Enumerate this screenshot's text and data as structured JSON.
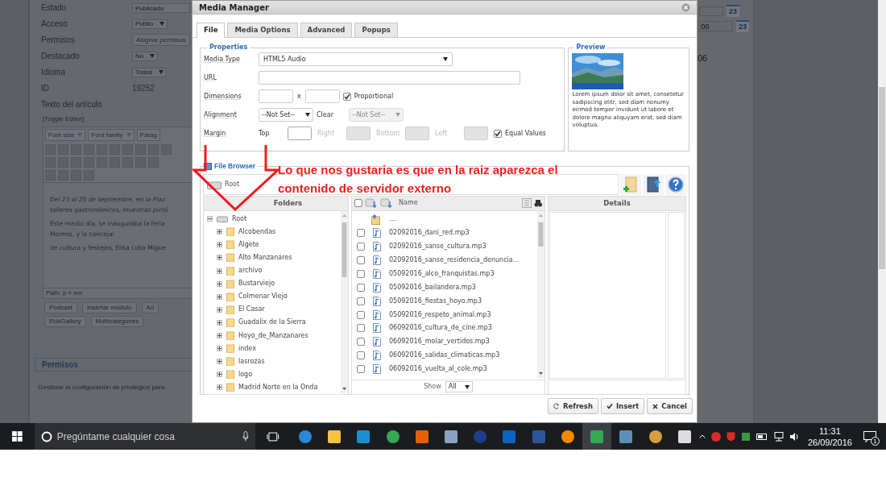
{
  "background_page": {
    "fields": [
      {
        "label": "Estado",
        "value": "Publicado",
        "kind": "text"
      },
      {
        "label": "Acceso",
        "value": "Publio",
        "kind": "select"
      },
      {
        "label": "Permisos",
        "value": "Asignar permisos",
        "kind": "button"
      },
      {
        "label": "Destacado",
        "value": "No",
        "kind": "select"
      },
      {
        "label": "Idioma",
        "value": "Todos",
        "kind": "select"
      },
      {
        "label": "ID",
        "value": "19252",
        "kind": "plain"
      }
    ],
    "article_label": "Texto del artículo",
    "toggle_editor": "[Toggle Editor]",
    "editor": {
      "dropdowns": [
        "Font size",
        "Font family",
        "Parag"
      ],
      "paragraphs": [
        {
          "lines": [
            "Del 23 al 25 de septiembre, en la Plaz",
            "talleres gastronómicos, muestras pictó"
          ],
          "italic": true
        },
        {
          "lines": [
            "Este medio día, se inauguraba la feria",
            "Moreno, y la concejal"
          ],
          "italic": false
        },
        {
          "lines": [
            "de cultura y festejos, Elisa Lidia Migue"
          ],
          "italic": false
        }
      ],
      "path": "Path: p » em"
    },
    "buttons": [
      "Podcast",
      "Insertar módulo",
      "Ad",
      "RokGallery",
      "Multicategories"
    ],
    "permissions": {
      "title": "Permisos",
      "description": "Gestione la configuración de privilegios para"
    },
    "right_values": [
      ":00",
      "06"
    ],
    "calendar_days": [
      "23",
      "23"
    ]
  },
  "dialog": {
    "title": "Media Manager",
    "tabs": [
      {
        "label": "File",
        "selected": true
      },
      {
        "label": "Media Options",
        "selected": false
      },
      {
        "label": "Advanced",
        "selected": false
      },
      {
        "label": "Popups",
        "selected": false
      }
    ],
    "properties": {
      "legend": "Properties",
      "media_type": {
        "label": "Media Type",
        "value": "HTML5 Audio"
      },
      "url": {
        "label": "URL"
      },
      "dimensions": {
        "label": "Dimensions",
        "separator": "x",
        "proportional": {
          "label": "Proportional",
          "checked": true
        }
      },
      "alignment": {
        "label": "Alignment",
        "value": "--Not Set--",
        "clear_label": "Clear",
        "clear_value": "--Not Set--",
        "clear_disabled": true
      },
      "margin": {
        "label": "Margin",
        "sides": [
          {
            "label": "Top",
            "disabled": false
          },
          {
            "label": "Right",
            "disabled": true
          },
          {
            "label": "Bottom",
            "disabled": true
          },
          {
            "label": "Left",
            "disabled": true
          }
        ],
        "equal_values": {
          "label": "Equal Values",
          "checked": true
        }
      }
    },
    "preview": {
      "legend": "Preview",
      "text": "Lorem ipsum dolor sit amet, consetetur sadipscing elitr, sed diam nonumy eirmod tempor invidunt ut labore et dolore magna aliquyam erat, sed diam voluptua."
    },
    "file_browser": {
      "legend": "File Browser",
      "breadcrumb": [
        "Root"
      ],
      "folders_header": "Folders",
      "folders": {
        "label": "Root",
        "expanded": true,
        "children": [
          {
            "label": "Alcobendas",
            "expanded": false
          },
          {
            "label": "Algete",
            "expanded": false
          },
          {
            "label": "Alto Manzanares",
            "expanded": false
          },
          {
            "label": "archivo",
            "expanded": false
          },
          {
            "label": "Bustarviejo",
            "expanded": false
          },
          {
            "label": "Colmenar Viejo",
            "expanded": false
          },
          {
            "label": "El Casar",
            "expanded": false
          },
          {
            "label": "Guadalix de la Sierra",
            "expanded": false
          },
          {
            "label": "Hoyo_de_Manzanares",
            "expanded": false
          },
          {
            "label": "index",
            "expanded": false
          },
          {
            "label": "lasrozas",
            "expanded": false
          },
          {
            "label": "logo",
            "expanded": false
          },
          {
            "label": "Madrid Norte en la Onda",
            "expanded": false
          }
        ]
      },
      "files_header": "Name",
      "select_all_checked": false,
      "parent_entry": "...",
      "files": [
        {
          "name": "02092016_dani_red.mp3",
          "checked": false
        },
        {
          "name": "02092016_sanse_cultura.mp3",
          "checked": false
        },
        {
          "name": "02092016_sanse_residencia_denuncia...",
          "checked": false
        },
        {
          "name": "05092016_alco_franquistas.mp3",
          "checked": false
        },
        {
          "name": "05092016_bailandera.mp3",
          "checked": false
        },
        {
          "name": "05092016_fiestas_hoyo.mp3",
          "checked": false
        },
        {
          "name": "05092016_respeto_animal.mp3",
          "checked": false
        },
        {
          "name": "06092016_cultura_de_cine.mp3",
          "checked": false
        },
        {
          "name": "06092016_molar_vertidos.mp3",
          "checked": false
        },
        {
          "name": "06092016_salidas_climaticas.mp3",
          "checked": false
        },
        {
          "name": "06092016_vuelta_al_cole.mp3",
          "checked": false
        }
      ],
      "show_label": "Show",
      "show_value": "All",
      "details_header": "Details"
    },
    "buttons": [
      {
        "label": "Refresh",
        "kind": "refresh"
      },
      {
        "label": "Insert",
        "kind": "insert"
      },
      {
        "label": "Cancel",
        "kind": "cancel"
      }
    ]
  },
  "annotation": {
    "text": "Lo que nos gustaria es que en la raiz aparezca el contenido de servidor externo"
  },
  "taskbar": {
    "search_placeholder": "Pregúntame cualquier cosa",
    "time": "11:31",
    "date": "26/09/2016",
    "notification_count": "1"
  }
}
